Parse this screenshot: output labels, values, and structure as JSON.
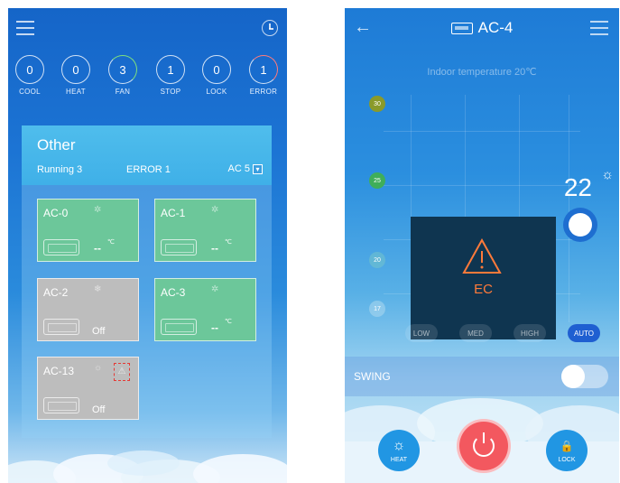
{
  "left": {
    "status": [
      {
        "count": "0",
        "label": "COOL"
      },
      {
        "count": "0",
        "label": "HEAT"
      },
      {
        "count": "3",
        "label": "FAN"
      },
      {
        "count": "1",
        "label": "STOP"
      },
      {
        "count": "0",
        "label": "LOCK"
      },
      {
        "count": "1",
        "label": "ERROR"
      }
    ],
    "group": {
      "title": "Other",
      "running": "Running 3",
      "error": "ERROR 1",
      "ac_count": "AC 5",
      "dropdown_glyph": "▾"
    },
    "tiles": [
      {
        "name": "AC-0",
        "mode_icon": "fan-icon",
        "mode_glyph": "✲",
        "temp": "--",
        "unit": "℃",
        "state": "on"
      },
      {
        "name": "AC-1",
        "mode_icon": "fan-icon",
        "mode_glyph": "✲",
        "temp": "--",
        "unit": "℃",
        "state": "on"
      },
      {
        "name": "AC-2",
        "mode_icon": "snow-icon",
        "mode_glyph": "❄",
        "off_label": "Off",
        "state": "off"
      },
      {
        "name": "AC-3",
        "mode_icon": "fan-icon",
        "mode_glyph": "✲",
        "temp": "--",
        "unit": "℃",
        "state": "on"
      },
      {
        "name": "AC-13",
        "mode_icon": "sun-icon",
        "mode_glyph": "☼",
        "warn_glyph": "⚠",
        "off_label": "Off",
        "state": "off"
      }
    ]
  },
  "right": {
    "device_name": "AC-4",
    "back_glyph": "←",
    "indoor_temperature": "Indoor temperature  20℃",
    "scale": [
      "30",
      "25",
      "20",
      "17"
    ],
    "setpoint": "22",
    "sun_glyph": "☼",
    "error_code": "EC",
    "fan_speeds": [
      "LOW",
      "MED",
      "HIGH",
      "AUTO"
    ],
    "active_fan_speed": "AUTO",
    "swing_label": "SWING",
    "swing_on": false,
    "heat_label": "HEAT",
    "heat_glyph": "☼",
    "lock_label": "LOCK",
    "lock_glyph": "🔒"
  },
  "colors": {
    "tile_on": "#6cc79a",
    "tile_off": "#bdbdbd",
    "error": "#ff7a3a",
    "power": "#f3585f"
  }
}
